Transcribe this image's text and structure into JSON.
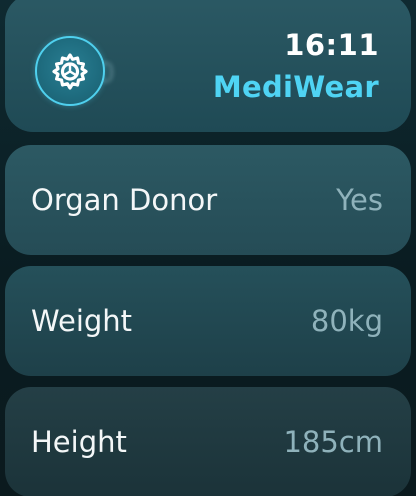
{
  "status": {
    "time": "16:11",
    "app_name": "MediWear"
  },
  "header": {
    "ghost_text": "0"
  },
  "colors": {
    "accent": "#4fd4f4",
    "card": "#2c5963",
    "background": "#0b1a1f"
  },
  "icons": {
    "settings": "gear-icon"
  },
  "rows": [
    {
      "label": "Organ Donor",
      "value": "Yes"
    },
    {
      "label": "Weight",
      "value": "80kg"
    },
    {
      "label": "Height",
      "value": "185cm"
    }
  ]
}
